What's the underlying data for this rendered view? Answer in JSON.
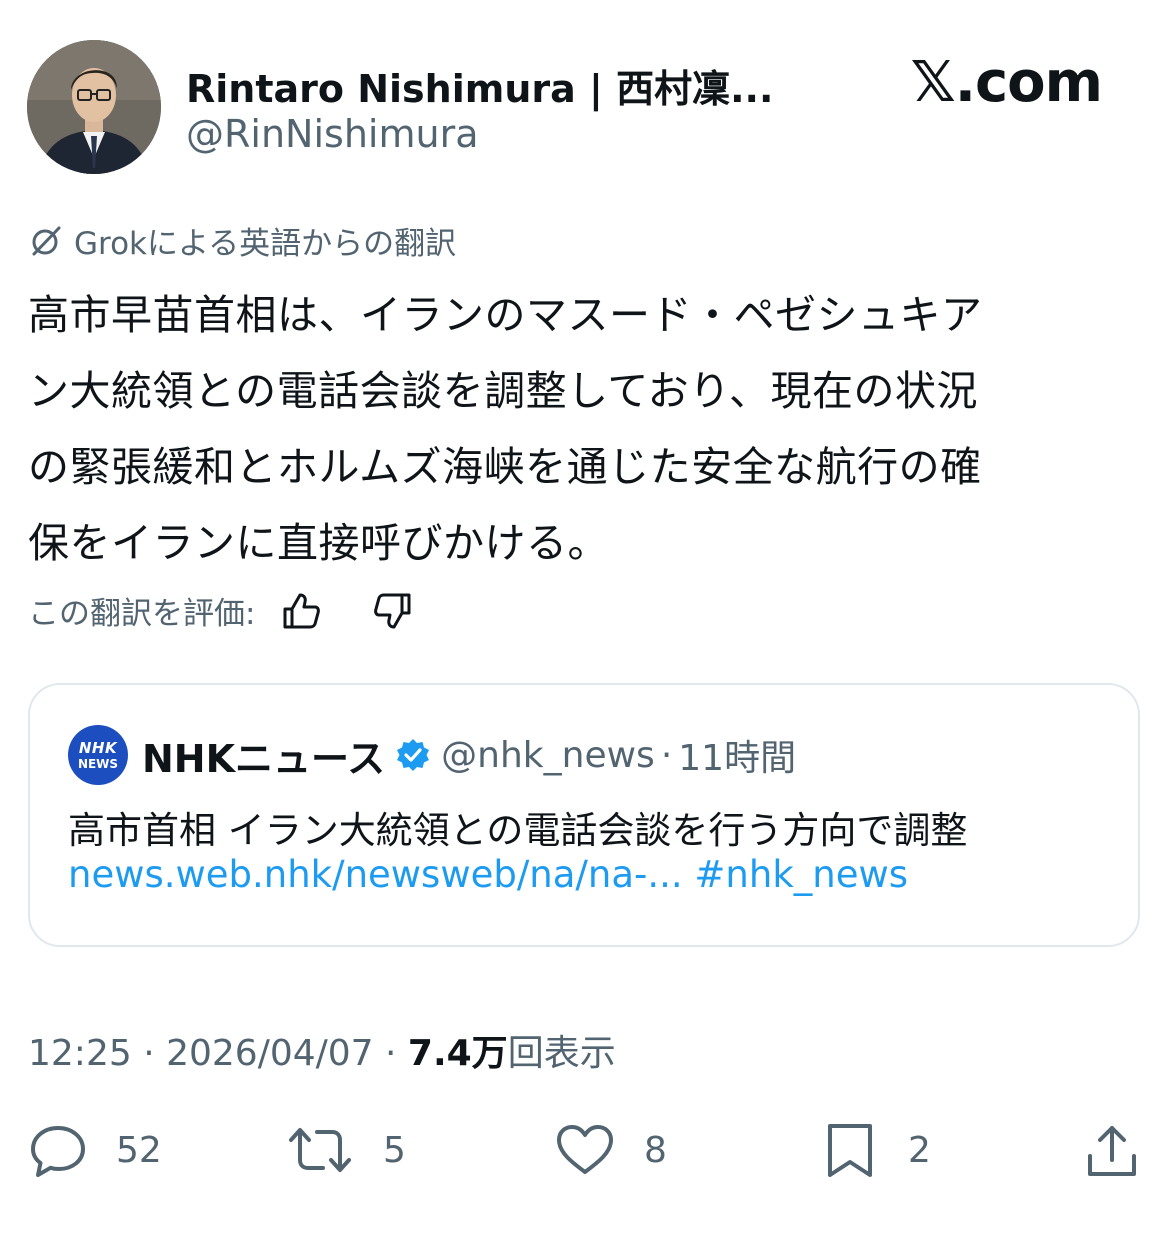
{
  "author": {
    "display_name": "Rintaro Nishimura | 西村凜...",
    "handle": "@RinNishimura"
  },
  "brand": "𝕏.com",
  "translation": {
    "note": "Grokによる英語からの翻訳",
    "rate_label": "この翻訳を評価:"
  },
  "post": {
    "lines": [
      "高市早苗首相は、イランのマスード・ペゼシュキア",
      "ン大統領との電話会談を調整しており、現在の状況",
      "の緊張緩和とホルムズ海峡を通じた安全な航行の確",
      "保をイランに直接呼びかける。"
    ],
    "timestamp": "12:25 · 2026/04/07 · ",
    "views_count": "7.4万",
    "views_label": "回表示"
  },
  "quote": {
    "logo_line1": "NHK",
    "logo_line2": "NEWS",
    "name": "NHKニュース",
    "handle": "@nhk_news",
    "separator": "·",
    "time": "11時間",
    "text": "高市首相 イラン大統領との電話会談を行う方向で調整",
    "link": "news.web.nhk/newsweb/na/na-...",
    "hashtag": "#nhk_news"
  },
  "actions": {
    "replies": "52",
    "reposts": "5",
    "likes": "8",
    "bookmarks": "2"
  },
  "colors": {
    "text_primary": "#0f1419",
    "text_secondary": "#536471",
    "link": "#1d9bf0",
    "verified": "#1d9bf0",
    "nhk_logo": "#1d4ec0",
    "card_border": "#e1e8ed"
  },
  "icons": [
    "grok-icon",
    "thumbs-up-icon",
    "thumbs-down-icon",
    "verified-badge-icon",
    "reply-icon",
    "repost-icon",
    "like-icon",
    "bookmark-icon",
    "share-icon"
  ]
}
